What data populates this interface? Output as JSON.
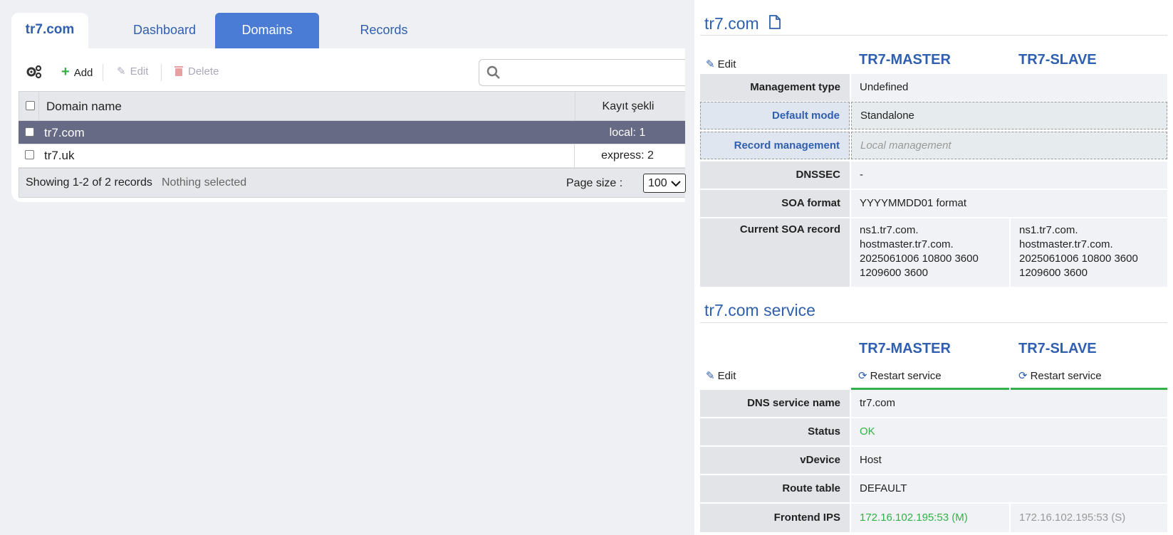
{
  "tabs": {
    "site": "tr7.com",
    "dashboard": "Dashboard",
    "domains": "Domains",
    "records": "Records"
  },
  "toolbar": {
    "add": "Add",
    "edit": "Edit",
    "delete": "Delete",
    "search_placeholder": ""
  },
  "grid": {
    "col_name": "Domain name",
    "col_kind": "Kayıt şekli",
    "rows": [
      {
        "name": "tr7.com",
        "kind": "local: 1"
      },
      {
        "name": "tr7.uk",
        "kind": "express: 2"
      }
    ],
    "footer_showing": "Showing 1-2 of 2 records",
    "footer_selected": "Nothing selected",
    "page_size_label": "Page size :",
    "page_size_value": "100"
  },
  "detail": {
    "title": "tr7.com",
    "edit": "Edit",
    "master": "TR7-MASTER",
    "slave": "TR7-SLAVE",
    "management_type": {
      "label": "Management type",
      "value": "Undefined"
    },
    "default_mode": {
      "label": "Default mode",
      "value": "Standalone"
    },
    "record_management": {
      "label": "Record management",
      "value": "Local management"
    },
    "dnssec": {
      "label": "DNSSEC",
      "value": "-"
    },
    "soa_format": {
      "label": "SOA format",
      "value": "YYYYMMDD01 format"
    },
    "current_soa": {
      "label": "Current SOA record",
      "master": [
        "ns1.tr7.com.",
        "hostmaster.tr7.com.",
        "2025061006 10800 3600",
        "1209600 3600"
      ],
      "slave": [
        "ns1.tr7.com.",
        "hostmaster.tr7.com.",
        "2025061006 10800 3600",
        "1209600 3600"
      ]
    }
  },
  "service": {
    "title": "tr7.com service",
    "edit": "Edit",
    "master": "TR7-MASTER",
    "slave": "TR7-SLAVE",
    "restart": "Restart service",
    "dns_service_name": {
      "label": "DNS service name",
      "value": "tr7.com"
    },
    "status": {
      "label": "Status",
      "value": "OK"
    },
    "vdevice": {
      "label": "vDevice",
      "value": "Host"
    },
    "route_table": {
      "label": "Route table",
      "value": "DEFAULT"
    },
    "frontend_ips": {
      "label": "Frontend IPS",
      "master": "172.16.102.195:53 (M)",
      "slave": "172.16.102.195:53 (S)"
    }
  },
  "colors": {
    "accent": "#2f5fae",
    "active_tab": "#4a7bd5",
    "selected_row": "#676a85",
    "ok": "#33b04a"
  }
}
